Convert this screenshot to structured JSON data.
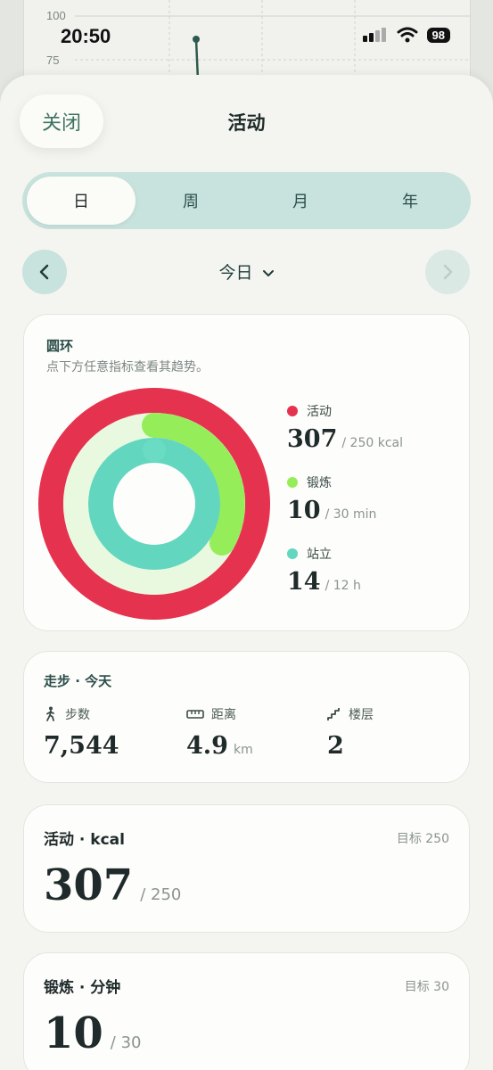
{
  "status": {
    "time": "20:50",
    "battery": "98"
  },
  "background_chart": {
    "ticks": [
      "100",
      "75"
    ]
  },
  "sheet": {
    "close_label": "关闭",
    "title": "活动"
  },
  "segments": [
    "日",
    "周",
    "月",
    "年"
  ],
  "selected_segment": "日",
  "date_nav": {
    "label": "今日"
  },
  "rings": {
    "title": "圆环",
    "subtitle": "点下方任意指标查看其趋势。",
    "items": [
      {
        "label": "活动",
        "value": "307",
        "goal": "/ 250 kcal",
        "color": "#e5334f"
      },
      {
        "label": "锻炼",
        "value": "10",
        "goal": "/ 30 min",
        "color": "#95ed5a"
      },
      {
        "label": "站立",
        "value": "14",
        "goal": "/ 12 h",
        "color": "#63d6bf"
      }
    ]
  },
  "walking": {
    "title": "走步  ·  今天",
    "stats": [
      {
        "label": "步数",
        "value": "7,544",
        "unit": ""
      },
      {
        "label": "距离",
        "value": "4.9",
        "unit": "km"
      },
      {
        "label": "楼层",
        "value": "2",
        "unit": ""
      }
    ]
  },
  "metrics": [
    {
      "title": "活动 · kcal",
      "goal": "目标 250",
      "value": "307",
      "of": "/ 250"
    },
    {
      "title": "锻炼 · 分钟",
      "goal": "目标 30",
      "value": "10",
      "of": "/ 30"
    }
  ]
}
